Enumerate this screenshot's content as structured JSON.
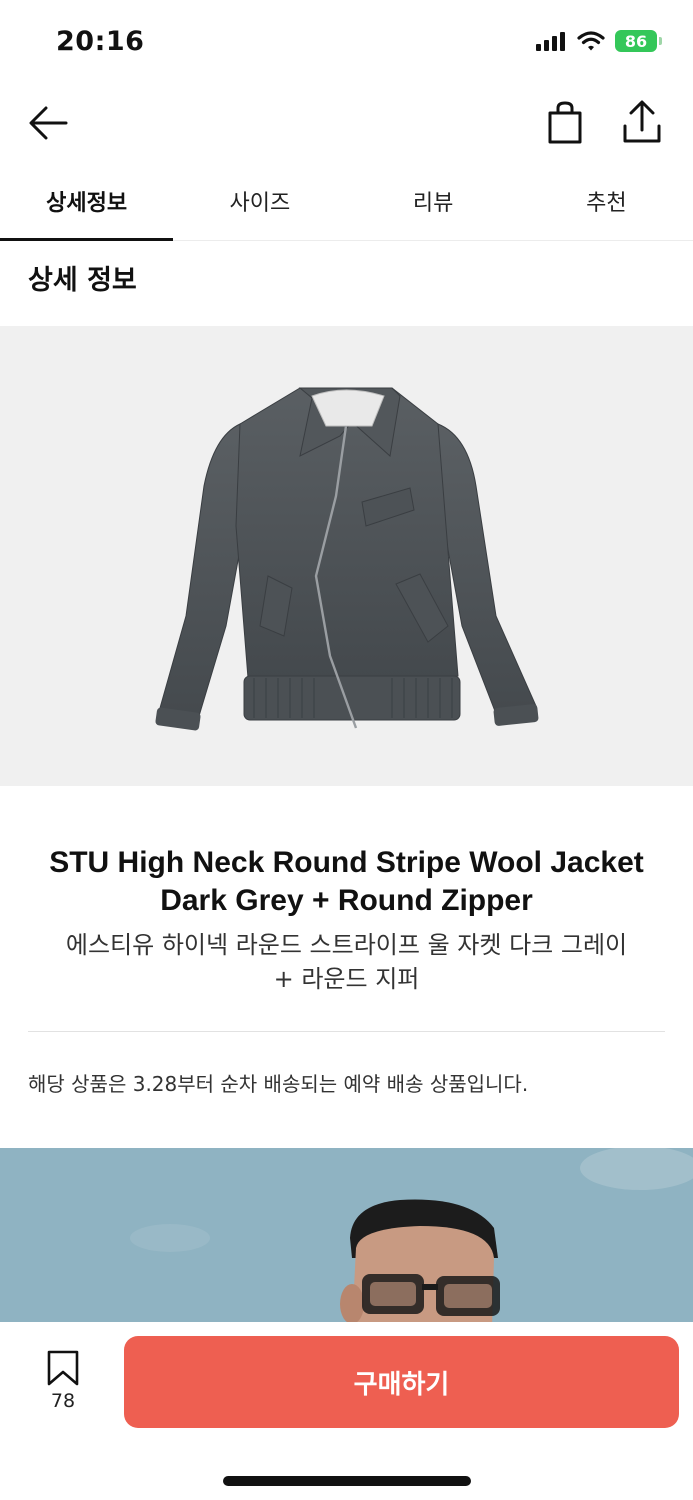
{
  "status_bar": {
    "time": "20:16",
    "battery": "86"
  },
  "tabs": [
    {
      "label": "상세정보",
      "active": true
    },
    {
      "label": "사이즈",
      "active": false
    },
    {
      "label": "리뷰",
      "active": false
    },
    {
      "label": "추천",
      "active": false
    }
  ],
  "section": {
    "heading": "상세 정보"
  },
  "product": {
    "title_en_line1": "STU High Neck Round Stripe Wool Jacket",
    "title_en_line2": "Dark Grey + Round Zipper",
    "title_ko_line1": "에스티유 하이넥 라운드 스트라이프 울 자켓 다크 그레이",
    "title_ko_line2": "+ 라운드 지퍼",
    "notice": "해당 상품은 3.28부터 순차 배송되는 예약 배송 상품입니다."
  },
  "bottom_bar": {
    "bookmark_count": "78",
    "buy_label": "구매하기"
  },
  "colors": {
    "accent": "#ee5f51",
    "battery": "#34c759",
    "sky": "#8fb3c2"
  }
}
